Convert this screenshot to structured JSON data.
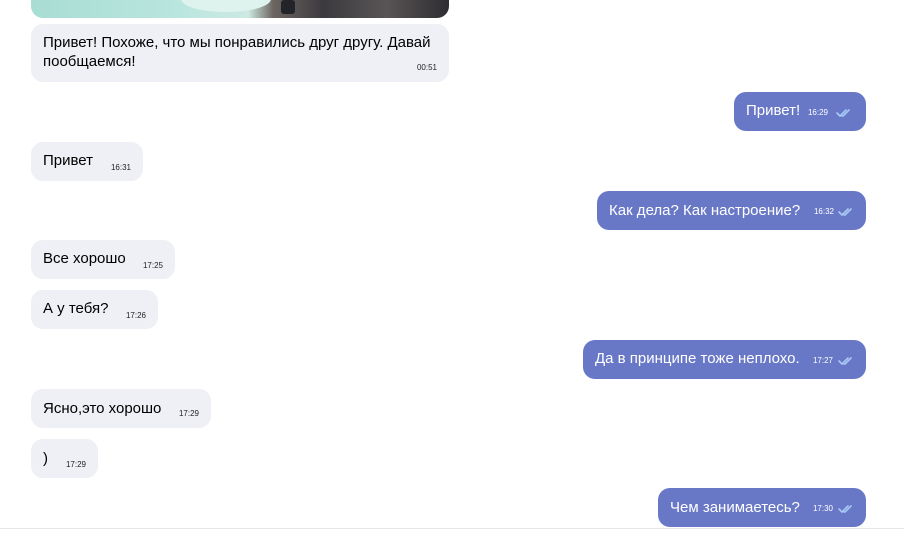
{
  "colors": {
    "incoming_bubble": "#eef0f5",
    "outgoing_bubble": "#6878c7",
    "read_check": "#a9c9f5"
  },
  "messages": [
    {
      "direction": "incoming",
      "lines": [
        "Привет! Похоже, что мы понравились друг другу. Давай",
        "пообщаемся!"
      ],
      "time": "00:51"
    },
    {
      "direction": "outgoing",
      "text": "Привет!",
      "time": "16:29",
      "status_icon": "double-check-icon"
    },
    {
      "direction": "incoming",
      "text": "Привет",
      "time": "16:31"
    },
    {
      "direction": "outgoing",
      "text": "Как дела? Как настроение?",
      "time": "16:32",
      "status_icon": "double-check-icon"
    },
    {
      "direction": "incoming",
      "text": "Все хорошо",
      "time": "17:25"
    },
    {
      "direction": "incoming",
      "text": "А у тебя?",
      "time": "17:26"
    },
    {
      "direction": "outgoing",
      "text": "Да в принципе тоже неплохо.",
      "time": "17:27",
      "status_icon": "double-check-icon"
    },
    {
      "direction": "incoming",
      "text": "Ясно,это хорошо",
      "time": "17:29"
    },
    {
      "direction": "incoming",
      "text": ")",
      "time": "17:29"
    },
    {
      "direction": "outgoing",
      "text": "Чем занимаетесь?",
      "time": "17:30",
      "status_icon": "double-check-icon"
    }
  ]
}
